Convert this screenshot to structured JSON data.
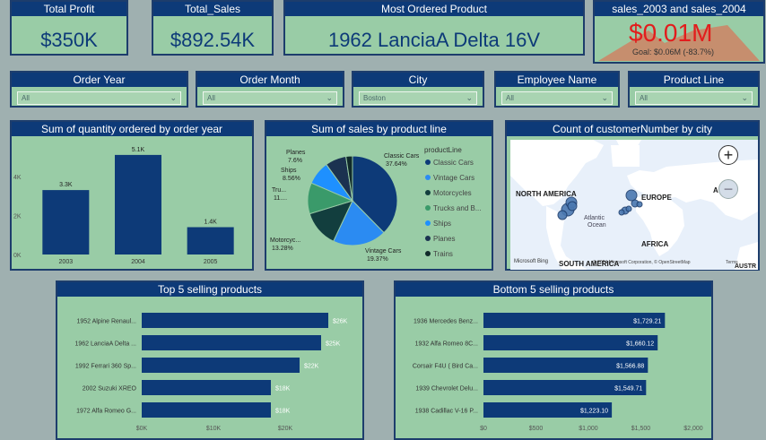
{
  "cards": {
    "total_profit": {
      "title": "Total Profit",
      "value": "$350K"
    },
    "total_sales": {
      "title": "Total_Sales",
      "value": "$892.54K"
    },
    "most_ordered": {
      "title": "Most Ordered Product",
      "value": "1962 LanciaA Delta 16V"
    }
  },
  "kpi": {
    "title": "sales_2003 and sales_2004",
    "value": "$0.01M",
    "goal": "Goal: $0.06M (-83.7%)"
  },
  "slicers": [
    {
      "label": "Order Year",
      "value": "All"
    },
    {
      "label": "Order Month",
      "value": "All"
    },
    {
      "label": "City",
      "value": "Boston"
    },
    {
      "label": "Employee Name",
      "value": "All"
    },
    {
      "label": "Product Line",
      "value": "All"
    }
  ],
  "qty_chart": {
    "title": "Sum of quantity ordered by order year",
    "chart_data": {
      "type": "bar",
      "categories": [
        "2003",
        "2004",
        "2005"
      ],
      "values": [
        3.3,
        5.1,
        1.4
      ],
      "data_labels": [
        "3.3K",
        "5.1K",
        "1.4K"
      ],
      "y_ticks": [
        "0K",
        "2K",
        "4K"
      ],
      "ylim": [
        0,
        5.6
      ],
      "color": "#0d3a78"
    }
  },
  "pie_chart": {
    "title": "Sum of sales by product line",
    "legend_title": "productLine",
    "chart_data": {
      "type": "pie",
      "slices": [
        {
          "name": "Classic Cars",
          "value": 37.64,
          "label": "Classic Cars",
          "pct": "37.64%",
          "color": "#0d3a78"
        },
        {
          "name": "Vintage Cars",
          "value": 19.37,
          "label": "Vintage Cars",
          "pct": "19.37%",
          "color": "#2b8bf2"
        },
        {
          "name": "Motorcycles",
          "value": 13.28,
          "label": "Motorcyc...",
          "pct": "13.28%",
          "color": "#123e3e"
        },
        {
          "name": "Trucks and B...",
          "value": 11.2,
          "label": "Tru...",
          "pct": "11....",
          "color": "#3a9a6a"
        },
        {
          "name": "Ships",
          "value": 8.56,
          "label": "Ships",
          "pct": "8.56%",
          "color": "#1e90ff"
        },
        {
          "name": "Planes",
          "value": 7.6,
          "label": "Planes",
          "pct": "7.6%",
          "color": "#1b3250"
        },
        {
          "name": "Trains",
          "value": 2.35,
          "label": "",
          "pct": "",
          "color": "#102a2a"
        }
      ]
    }
  },
  "map": {
    "title": "Count of customerNumber by city",
    "labels": {
      "north_america": "NORTH AMERICA",
      "europe": "EUROPE",
      "atlantic1": "Atlantic",
      "atlantic2": "Ocean",
      "africa": "AFRICA",
      "south_america": "SOUTH AMERICA",
      "asia": "A",
      "austr": "AUSTR"
    },
    "attribution": "© 2024 Microsoft Corporation, © OpenStreetMap",
    "terms": "Terms",
    "bing": "Microsoft Bing",
    "zoom_in": "+",
    "zoom_out": "−"
  },
  "top5": {
    "title": "Top 5 selling products",
    "chart_data": {
      "type": "bar",
      "orientation": "horizontal",
      "categories": [
        "1952 Alpine Renaul...",
        "1962 LanciaA Delta ...",
        "1992 Ferrari 360 Sp...",
        "2002 Suzuki XREO",
        "1972 Alfa Romeo G..."
      ],
      "values": [
        26,
        25,
        22,
        18,
        18
      ],
      "data_labels": [
        "$26K",
        "$25K",
        "$22K",
        "$18K",
        "$18K"
      ],
      "x_ticks": [
        "$0K",
        "$10K",
        "$20K"
      ],
      "xlim": [
        0,
        32
      ]
    }
  },
  "bottom5": {
    "title": "Bottom 5 selling products",
    "chart_data": {
      "type": "bar",
      "orientation": "horizontal",
      "categories": [
        "1936 Mercedes Benz...",
        "1932 Alfa Romeo 8C...",
        "Corsair F4U ( Bird Ca...",
        "1939 Chevrolet Delu...",
        "1938 Cadillac V-16 P..."
      ],
      "values": [
        1729.21,
        1660.12,
        1566.88,
        1549.71,
        1223.1
      ],
      "data_labels": [
        "$1,729.21",
        "$1,660.12",
        "$1,566.88",
        "$1,549.71",
        "$1,223.10"
      ],
      "x_ticks": [
        "$0",
        "$500",
        "$1,000",
        "$1,500",
        "$2,000"
      ],
      "xlim": [
        0,
        2000
      ]
    }
  }
}
